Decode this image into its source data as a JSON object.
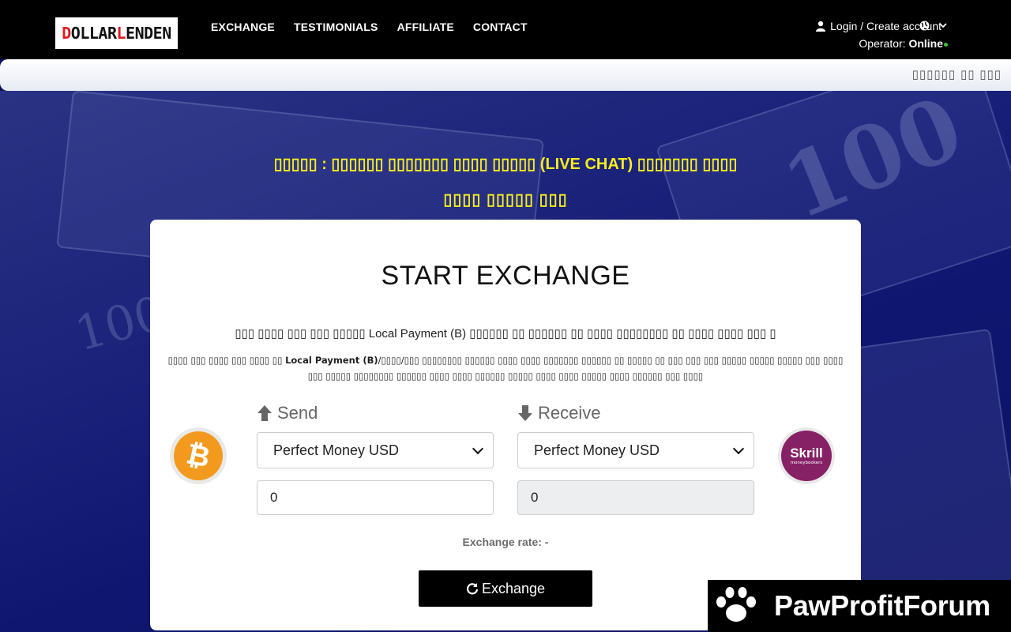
{
  "header": {
    "logo": {
      "part1_accent": "D",
      "part1": "OLLAR ",
      "part2_accent": "L",
      "part2": "ENDEN"
    },
    "nav": [
      {
        "label": "EXCHANGE"
      },
      {
        "label": "TESTIMONIALS"
      },
      {
        "label": "AFFILIATE"
      },
      {
        "label": "CONTACT"
      }
    ],
    "account_label": "Login / Create account",
    "operator_label": "Operator:",
    "operator_status": "Online"
  },
  "ticker": {
    "text": "▯▯▯▯▯▯ ▯▯ ▯▯▯"
  },
  "hero": {
    "notice_line1": "▯▯▯▯▯ : ▯▯▯▯▯▯ ▯▯▯▯▯▯▯ ▯▯▯▯ ▯▯▯▯▯ (LIVE CHAT) ▯▯▯▯▯▯▯ ▯▯▯▯",
    "notice_line2": "▯▯▯▯ ▯▯▯▯▯ ▯▯▯",
    "notice_color": "#f6ee1a"
  },
  "card": {
    "title": "START EXCHANGE",
    "info_line": "▯▯▯ ▯▯▯▯ ▯▯▯ ▯▯▯ ▯▯▯▯▯ Local Payment (B) ▯▯▯▯▯▯ ▯▯ ▯▯▯▯▯▯ ▯▯ ▯▯▯▯ ▯▯▯▯▯▯▯▯ ▯▯ ▯▯▯▯ ▯▯▯▯ ▯▯▯ ▯",
    "info_small_pre": "▯▯▯▯ ▯▯▯ ▯▯▯▯ ▯▯▯ ▯▯▯▯ ▯▯ ",
    "info_small_bold": "Local Payment (B)",
    "info_small_post": "/▯▯▯▯/▯▯▯ ▯▯▯▯▯▯▯▯ ▯▯▯▯▯▯ ▯▯▯▯ ▯▯▯▯ ▯▯▯▯▯▯▯ ▯▯▯▯▯▯ ▯▯ ▯▯▯▯▯ ▯▯ ▯▯▯ ▯▯▯ ▯▯▯ ▯▯▯▯▯ ▯▯▯▯▯ ▯▯▯▯▯ ▯▯▯ ▯▯▯▯ ▯▯▯ ▯▯▯▯▯ ▯▯▯▯▯▯▯▯ ▯▯▯▯▯▯ ▯▯▯▯ ▯▯▯▯ ▯▯▯▯▯▯ ▯▯▯▯▯ ▯▯▯▯ ▯▯▯▯ ▯▯▯▯▯ ▯▯▯▯ ▯▯▯▯▯▯ ▯▯▯ ▯▯▯▯",
    "send_label": "Send",
    "receive_label": "Receive",
    "send_currency": "Perfect Money USD",
    "receive_currency": "Perfect Money USD",
    "send_amount": "0",
    "receive_amount": "0",
    "rate_label": "Exchange rate: -",
    "exchange_button": "Exchange",
    "send_icon": "bitcoin-logo",
    "receive_icon": "skrill-logo",
    "receive_logo_text": "Skrill",
    "receive_logo_subtext": "moneybookers",
    "bitcoin_color": "#f39a1e",
    "skrill_color": "#862165"
  },
  "watermark": {
    "text": "PawProfitForum"
  }
}
